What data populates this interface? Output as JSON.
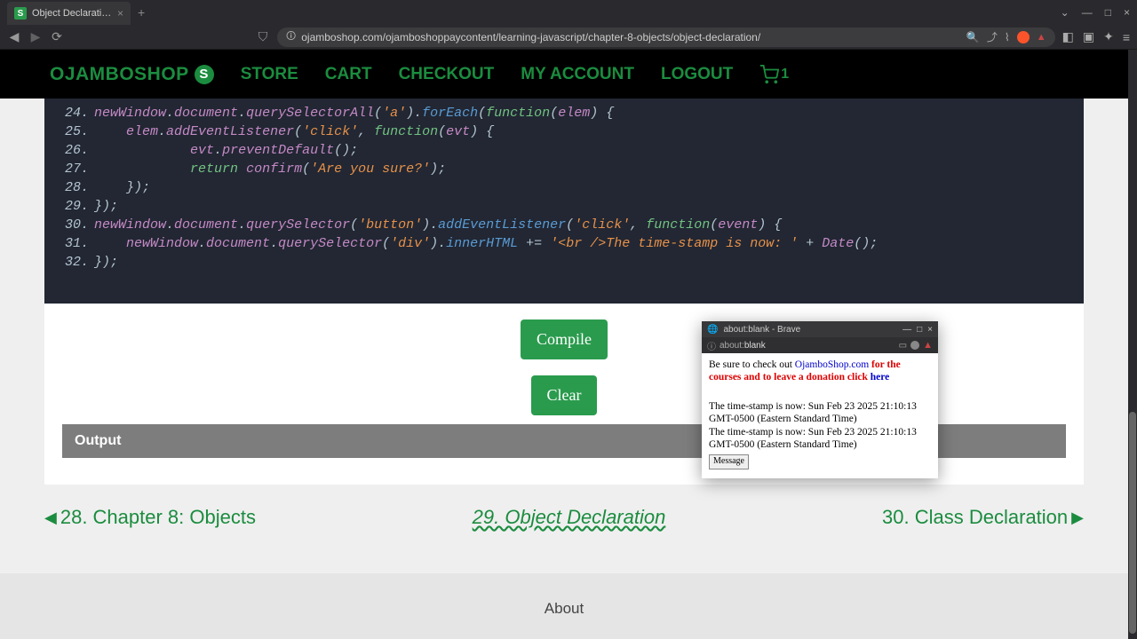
{
  "browser": {
    "tab_title": "Object Declaration - Ojamb",
    "url": "ojamboshop.com/ojamboshoppaycontent/learning-javascript/chapter-8-objects/object-declaration/"
  },
  "nav": {
    "brand": "OJAMBOSHOP",
    "brand_badge": "S",
    "links": [
      "STORE",
      "CART",
      "CHECKOUT",
      "MY ACCOUNT",
      "LOGOUT"
    ],
    "cart_count": "1"
  },
  "code": {
    "lines": [
      {
        "n": "24.",
        "segs": [
          [
            "id",
            "newWindow"
          ],
          [
            "p",
            "."
          ],
          [
            "id",
            "document"
          ],
          [
            "p",
            "."
          ],
          [
            "id",
            "querySelectorAll"
          ],
          [
            "p",
            "("
          ],
          [
            "str",
            "'a'"
          ],
          [
            "p",
            ")."
          ],
          [
            "fn",
            "forEach"
          ],
          [
            "p",
            "("
          ],
          [
            "kw",
            "function"
          ],
          [
            "p",
            "("
          ],
          [
            "id",
            "elem"
          ],
          [
            "p",
            ") {"
          ]
        ]
      },
      {
        "n": "25.",
        "segs": [
          [
            "p",
            "    "
          ],
          [
            "id",
            "elem"
          ],
          [
            "p",
            "."
          ],
          [
            "id",
            "addEventListener"
          ],
          [
            "p",
            "("
          ],
          [
            "str",
            "'click'"
          ],
          [
            "p",
            ", "
          ],
          [
            "kw",
            "function"
          ],
          [
            "p",
            "("
          ],
          [
            "id",
            "evt"
          ],
          [
            "p",
            ") {"
          ]
        ]
      },
      {
        "n": "26.",
        "segs": [
          [
            "p",
            "            "
          ],
          [
            "id",
            "evt"
          ],
          [
            "p",
            "."
          ],
          [
            "id",
            "preventDefault"
          ],
          [
            "p",
            "();"
          ]
        ]
      },
      {
        "n": "27.",
        "segs": [
          [
            "p",
            "            "
          ],
          [
            "kw",
            "return"
          ],
          [
            "p",
            " "
          ],
          [
            "id",
            "confirm"
          ],
          [
            "p",
            "("
          ],
          [
            "str",
            "'Are you sure?'"
          ],
          [
            "p",
            ");"
          ]
        ]
      },
      {
        "n": "28.",
        "segs": [
          [
            "p",
            "    });"
          ]
        ]
      },
      {
        "n": "29.",
        "segs": [
          [
            "p",
            "});"
          ]
        ]
      },
      {
        "n": "30.",
        "segs": [
          [
            "id",
            "newWindow"
          ],
          [
            "p",
            "."
          ],
          [
            "id",
            "document"
          ],
          [
            "p",
            "."
          ],
          [
            "id",
            "querySelector"
          ],
          [
            "p",
            "("
          ],
          [
            "str",
            "'button'"
          ],
          [
            "p",
            ")."
          ],
          [
            "fn",
            "addEventListener"
          ],
          [
            "p",
            "("
          ],
          [
            "str",
            "'click'"
          ],
          [
            "p",
            ", "
          ],
          [
            "kw",
            "function"
          ],
          [
            "p",
            "("
          ],
          [
            "id",
            "event"
          ],
          [
            "p",
            ") {"
          ]
        ]
      },
      {
        "n": "31.",
        "segs": [
          [
            "p",
            "    "
          ],
          [
            "id",
            "newWindow"
          ],
          [
            "p",
            "."
          ],
          [
            "id",
            "document"
          ],
          [
            "p",
            "."
          ],
          [
            "id",
            "querySelector"
          ],
          [
            "p",
            "("
          ],
          [
            "str",
            "'div'"
          ],
          [
            "p",
            ")."
          ],
          [
            "fn",
            "innerHTML"
          ],
          [
            "p",
            " += "
          ],
          [
            "str",
            "'<br />The time-stamp is now: '"
          ],
          [
            "p",
            " + "
          ],
          [
            "id",
            "Date"
          ],
          [
            "p",
            "();"
          ]
        ]
      },
      {
        "n": "32.",
        "segs": [
          [
            "p",
            "});"
          ]
        ]
      }
    ]
  },
  "buttons": {
    "compile": "Compile",
    "clear": "Clear"
  },
  "output_label": "Output",
  "pager": {
    "prev": "28. Chapter 8: Objects",
    "current": "29. Object Declaration",
    "next": "30. Class Declaration"
  },
  "footer": {
    "about": "About"
  },
  "popup": {
    "title": "about:blank - Brave",
    "addr_prefix": "about:",
    "addr_suffix": "blank",
    "line1_a": "Be sure to check out ",
    "line1_link": "OjamboShop.com",
    "line1_b": " for the courses and to leave a donation click ",
    "line1_here": "here",
    "ts1": "The time-stamp is now: Sun Feb 23 2025 21:10:13 GMT-0500 (Eastern Standard Time)",
    "ts2": "The time-stamp is now: Sun Feb 23 2025 21:10:13 GMT-0500 (Eastern Standard Time)",
    "btn": "Message"
  }
}
